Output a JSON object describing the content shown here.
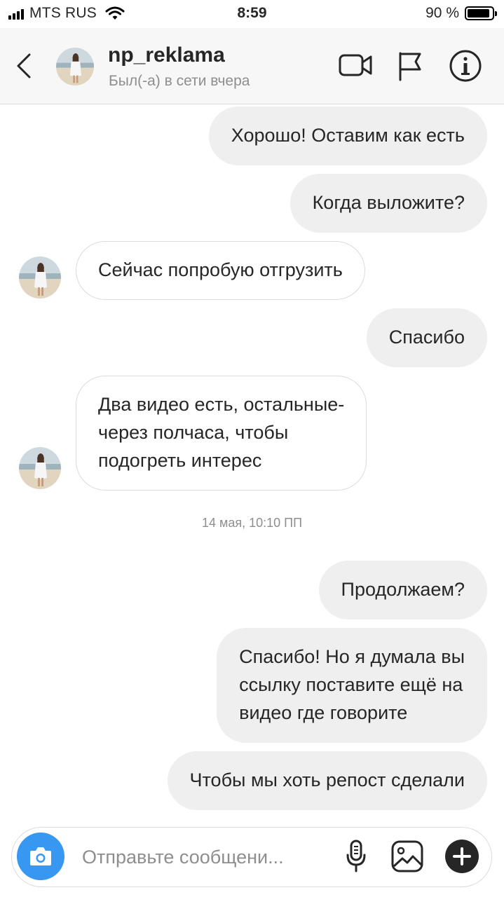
{
  "status_bar": {
    "carrier": "MTS RUS",
    "time": "8:59",
    "battery_text": "90 %",
    "battery_level": 0.9
  },
  "header": {
    "username": "np_reklama",
    "subtitle": "Был(-а) в сети вчера",
    "icons": [
      "chevron-left-icon",
      "avatar",
      "video-camera-icon",
      "flag-icon",
      "info-icon"
    ]
  },
  "messages": [
    {
      "direction": "outgoing",
      "text": "Хорошо! Оставим как есть"
    },
    {
      "direction": "outgoing",
      "text": "Когда выложите?"
    },
    {
      "direction": "incoming",
      "text": "Сейчас попробую отгрузить"
    },
    {
      "direction": "outgoing",
      "text": "Спасибо"
    },
    {
      "direction": "incoming",
      "text": "Два видео есть, остальные-\nчерез полчаса, чтобы\nподогреть интерес"
    },
    {
      "direction": "outgoing",
      "text": "Продолжаем?"
    },
    {
      "direction": "outgoing",
      "text": "Спасибо! Но я думала вы\nссылку поставите ещё на\nвидео где говорите"
    },
    {
      "direction": "outgoing",
      "text": "Чтобы мы хоть репост сделали"
    }
  ],
  "timestamp": "14 мая, 10:10 ПП",
  "composer": {
    "placeholder": "Отправьте сообщени...",
    "value": "",
    "icons": [
      "camera-icon",
      "microphone-icon",
      "image-icon",
      "plus-icon"
    ]
  },
  "colors": {
    "accent_blue": "#3897f0",
    "outgoing_bubble": "#efefef",
    "incoming_border": "#dbdbdb",
    "header_bg": "#f7f7f7",
    "secondary_text": "#8e8e8e"
  }
}
